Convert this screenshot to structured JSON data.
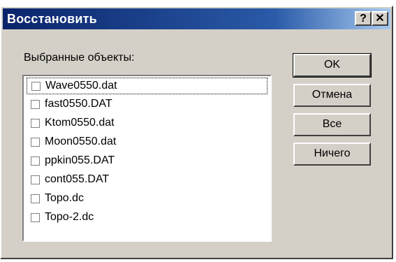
{
  "window": {
    "title": "Восстановить",
    "help_label": "?",
    "close_label": "✕"
  },
  "list": {
    "label": "Выбранные объекты:",
    "items": [
      {
        "label": "Wave0550.dat",
        "checked": false
      },
      {
        "label": "fast0550.DAT",
        "checked": false
      },
      {
        "label": "Ktom0550.dat",
        "checked": false
      },
      {
        "label": "Moon0550.dat",
        "checked": false
      },
      {
        "label": "ppkin055.DAT",
        "checked": false
      },
      {
        "label": "cont055.DAT",
        "checked": false
      },
      {
        "label": "Topo.dc",
        "checked": false
      },
      {
        "label": "Topo-2.dc",
        "checked": false
      }
    ]
  },
  "buttons": {
    "ok": "OK",
    "cancel": "Отмена",
    "all": "Все",
    "none": "Ничего"
  }
}
